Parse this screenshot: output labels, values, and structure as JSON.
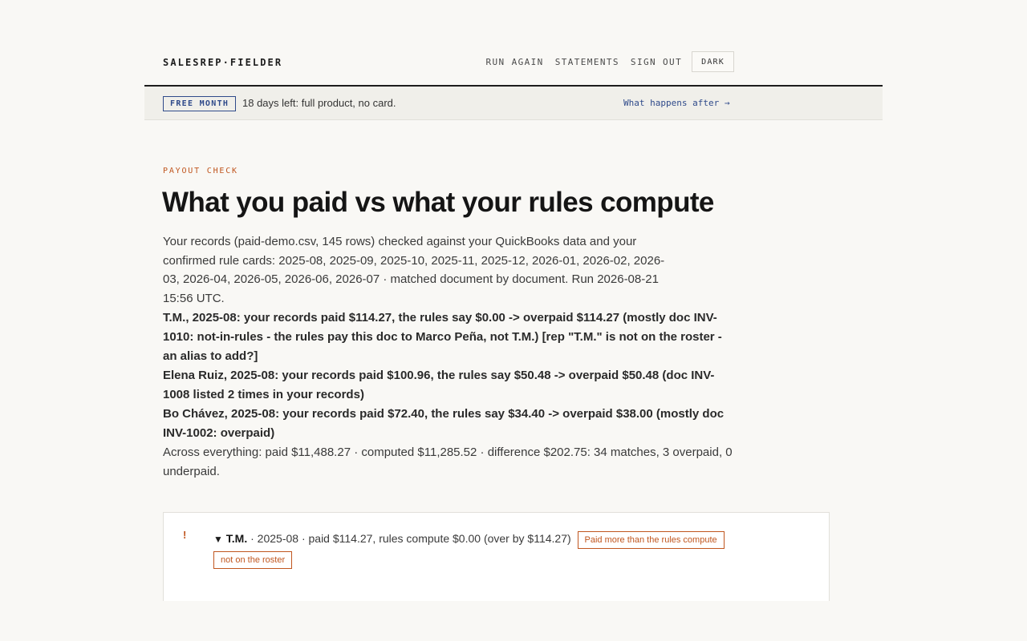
{
  "header": {
    "brand": "SALESREP·FIELDER",
    "nav": {
      "run_again": "RUN AGAIN",
      "statements": "STATEMENTS",
      "sign_out": "SIGN OUT",
      "theme_toggle": "DARK"
    }
  },
  "trial": {
    "badge": "FREE MONTH",
    "text": "18 days left: full product, no card.",
    "link": "What happens after →"
  },
  "main": {
    "eyebrow": "PAYOUT CHECK",
    "title": "What you paid vs what your rules compute",
    "intro": "Your records (paid-demo.csv, 145 rows) checked against your QuickBooks data and your confirmed rule cards: 2025-08, 2025-09, 2025-10, 2025-11, 2025-12, 2026-01, 2026-02, 2026-03, 2026-04, 2026-05, 2026-06, 2026-07 · matched document by document. Run 2026-08-21 15:56 UTC.",
    "findings": [
      "T.M., 2025-08: your records paid $114.27, the rules say $0.00 -> overpaid $114.27 (mostly doc INV-1010: not-in-rules - the rules pay this doc to Marco Peña, not T.M.) [rep \"T.M.\" is not on the roster - an alias to add?]",
      "Elena Ruiz, 2025-08: your records paid $100.96, the rules say $50.48 -> overpaid $50.48 (doc INV-1008 listed 2 times in your records)",
      "Bo Chávez, 2025-08: your records paid $72.40, the rules say $34.40 -> overpaid $38.00 (mostly doc INV-1002: overpaid)"
    ],
    "totals": "Across everything: paid $11,488.27 · computed $11,285.52 · difference $202.75: 34 matches, 3 overpaid, 0 underpaid."
  },
  "rows": [
    {
      "alert_glyph": "!",
      "caret": "▼",
      "rep": "T.M.",
      "detail": " · 2025-08 · paid $114.27, rules compute $0.00 (over by $114.27)",
      "tags": [
        "Paid more than the rules compute",
        "not on the roster"
      ]
    }
  ],
  "colors": {
    "accent": "#c0561f",
    "link": "#2f4a8a",
    "background": "#f9f8f5",
    "ink": "#151515"
  },
  "icons": {
    "alert": "alert-icon",
    "caret": "caret-down-icon"
  }
}
